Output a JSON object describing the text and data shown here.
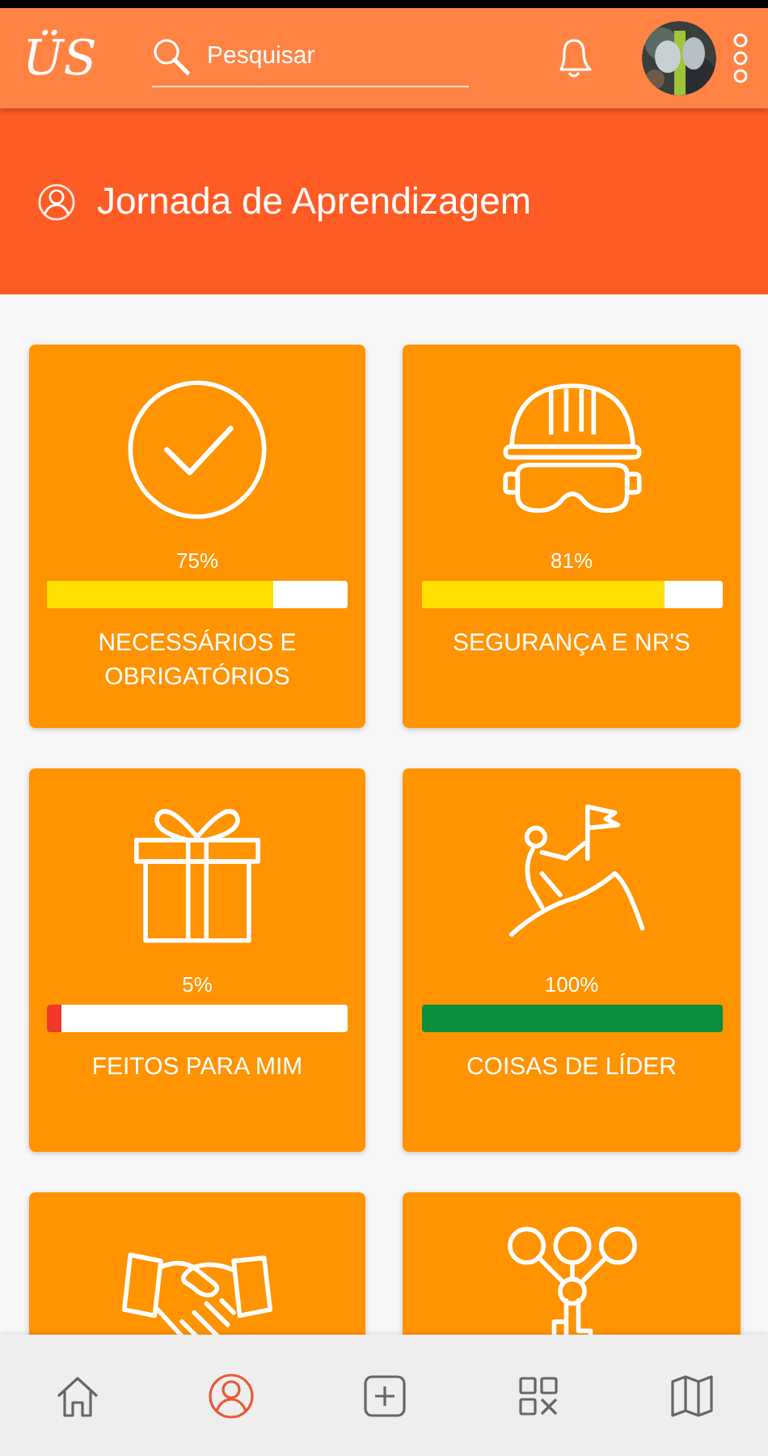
{
  "header": {
    "logo": "ÜS",
    "search": {
      "placeholder": "Pesquisar"
    }
  },
  "title": "Jornada de Aprendizagem",
  "cards": [
    {
      "kind": "progress",
      "percent": "75%",
      "level": 0.75,
      "color": "#ffe000",
      "label": "NECESSÁRIOS E OBRIGATÓRIOS"
    },
    {
      "kind": "progress",
      "percent": "81%",
      "level": 0.81,
      "color": "#ffe000",
      "label": "SEGURANÇA E NR'S"
    },
    {
      "kind": "progress",
      "percent": "5%",
      "level": 0.05,
      "color": "#f0392b",
      "label": "FEITOS PARA MIM"
    },
    {
      "kind": "progress",
      "percent": "100%",
      "level": 1,
      "color": "#0a8f3c",
      "label": "COISAS DE LÍDER"
    },
    {
      "kind": "plain"
    },
    {
      "kind": "plain"
    }
  ],
  "nav": [
    {
      "selected": false
    },
    {
      "selected": true
    },
    {
      "selected": false
    },
    {
      "selected": false
    },
    {
      "selected": false
    }
  ]
}
